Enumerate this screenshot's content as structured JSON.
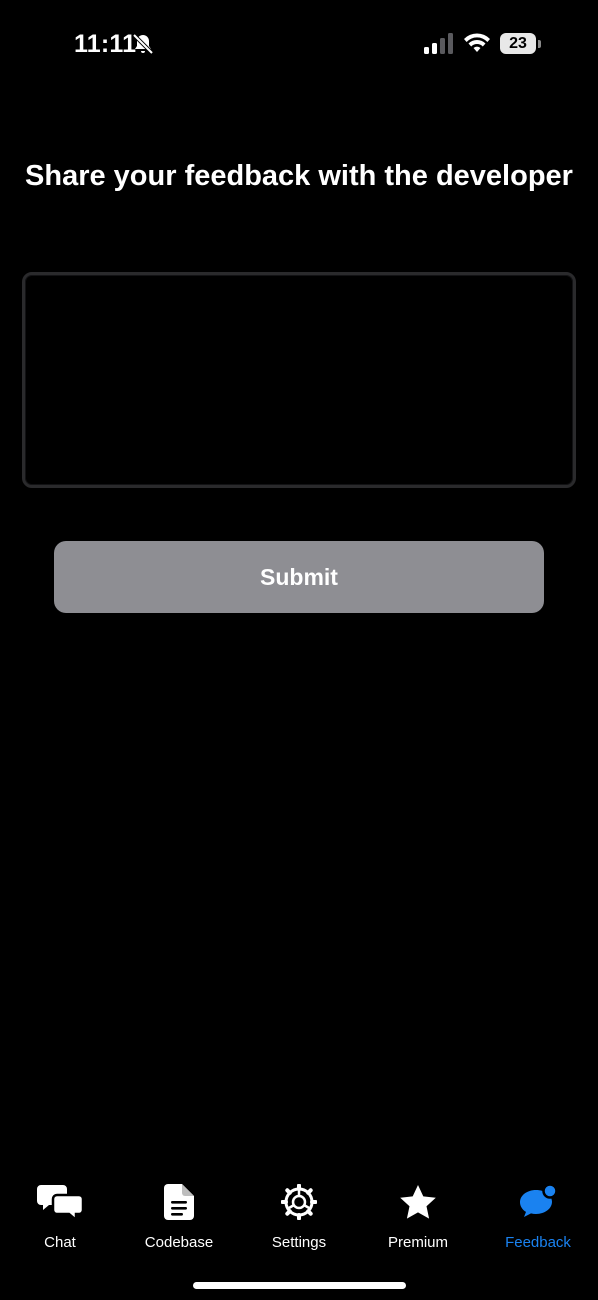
{
  "status_bar": {
    "time": "11:11",
    "battery_level": "23",
    "icons": [
      "bell-off-icon",
      "cellular-signal-icon",
      "wifi-icon",
      "battery-icon"
    ]
  },
  "main": {
    "title": "Share your feedback with the developer",
    "feedback_value": "",
    "submit_label": "Submit"
  },
  "tabs": [
    {
      "label": "Chat",
      "icon": "chat-bubbles-icon",
      "active": false
    },
    {
      "label": "Codebase",
      "icon": "document-icon",
      "active": false
    },
    {
      "label": "Settings",
      "icon": "gear-icon",
      "active": false
    },
    {
      "label": "Premium",
      "icon": "star-icon",
      "active": false
    },
    {
      "label": "Feedback",
      "icon": "feedback-bubble-icon",
      "active": true
    }
  ],
  "colors": {
    "background": "#000000",
    "submit_button": "#8e8e93",
    "active_tab": "#1a82f0",
    "text": "#ffffff"
  }
}
